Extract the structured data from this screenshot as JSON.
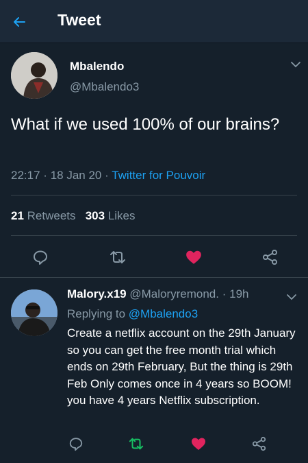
{
  "header": {
    "title": "Tweet",
    "back_icon": "arrow-left-icon"
  },
  "tweet": {
    "author_name": "Mbalendo",
    "author_handle": "@Mbalendo3",
    "text": "What if we used 100% of our brains?",
    "time": "22:17",
    "date": "18 Jan 20",
    "source": "Twitter for Pouvoir",
    "retweets": "21",
    "retweets_label": "Retweets",
    "likes": "303",
    "likes_label": "Likes",
    "sep": "·"
  },
  "reply": {
    "author_name": "Malory.x19",
    "author_handle": "@Maloryremond.",
    "age": "19h",
    "replying_prefix": "Replying to",
    "replying_to": "@Mbalendo3",
    "text": "Create a netflix account on the 29th January so you can get the free month trial which ends on 29th February, But the thing is 29th Feb Only comes once in 4 years so BOOM! you have 4 years Netflix subscription.",
    "sep": "·"
  },
  "colors": {
    "background": "#15202b",
    "header": "#1c2938",
    "accent": "#1da1f2",
    "secondary_text": "#8899a6",
    "like": "#e0245e",
    "retweet": "#17bf63"
  }
}
